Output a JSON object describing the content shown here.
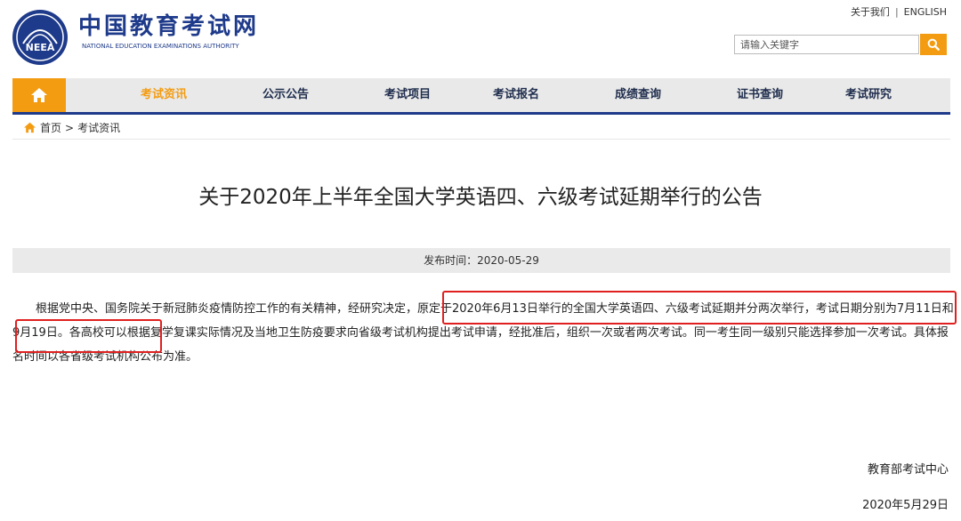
{
  "header": {
    "logo_emblem_text": "NEEA",
    "logo_cn": "中国教育考试网",
    "logo_en": "NATIONAL EDUCATION EXAMINATIONS AUTHORITY",
    "top_links": [
      "关于我们",
      "ENGLISH"
    ],
    "search": {
      "placeholder": "请输入关键字",
      "value": ""
    },
    "colors": {
      "brand_blue": "#1e3a8a",
      "accent_orange": "#f39c12"
    }
  },
  "nav": {
    "home_icon": "home-icon",
    "items": [
      "考试资讯",
      "公示公告",
      "考试项目",
      "考试报名",
      "成绩查询",
      "证书查询",
      "考试研究"
    ],
    "active_index": 0
  },
  "breadcrumb": {
    "icon": "home-icon",
    "items": [
      "首页",
      "考试资讯"
    ]
  },
  "article": {
    "title": "关于2020年上半年全国大学英语四、六级考试延期举行的公告",
    "publish_label": "发布时间：",
    "publish_date": "2020-05-29",
    "body": "根据党中央、国务院关于新冠肺炎疫情防控工作的有关精神，经研究决定，原定于2020年6月13日举行的全国大学英语四、六级考试延期并分两次举行，考试日期分别为7月11日和9月19日。各高校可以根据复学复课实际情况及当地卫生防疫要求向省级考试机构提出考试申请，经批准后，组织一次或者两次考试。同一考生同一级别只能选择参加一次考试。具体报名时间以各省级考试机构公布为准。",
    "signature_org": "教育部考试中心",
    "signature_date": "2020年5月29日"
  },
  "annotations": {
    "highlight_color": "#e02020"
  }
}
